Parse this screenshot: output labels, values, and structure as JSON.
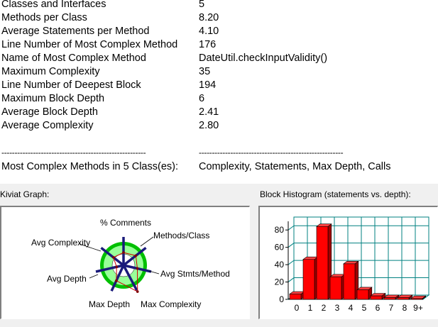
{
  "metrics": [
    {
      "label": "Classes and Interfaces",
      "value": "5"
    },
    {
      "label": "Methods per Class",
      "value": "8.20"
    },
    {
      "label": "Average Statements per Method",
      "value": "4.10"
    },
    {
      "label": "Line Number of Most Complex Method",
      "value": "176"
    },
    {
      "label": "Name of Most Complex Method",
      "value": "DateUtil.checkInputValidity()"
    },
    {
      "label": "Maximum Complexity",
      "value": "35"
    },
    {
      "label": "Line Number of Deepest Block",
      "value": "194"
    },
    {
      "label": "Maximum Block Depth",
      "value": "6"
    },
    {
      "label": "Average Block Depth",
      "value": "2.41"
    },
    {
      "label": "Average Complexity",
      "value": "2.80"
    }
  ],
  "separator_left": "-------------------------------------------------------",
  "separator_right": "-------------------------------------------------------",
  "most_complex": {
    "label": "Most Complex Methods in 5 Class(es):",
    "value": "Complexity, Statements, Max Depth, Calls"
  },
  "kiviat": {
    "title": "Kiviat Graph:",
    "axes": [
      "% Comments",
      "Methods/Class",
      "Avg Stmts/Method",
      "Max Complexity",
      "Max Depth",
      "Avg Depth",
      "Avg Complexity"
    ],
    "ring_color": "#99ff99",
    "outer_ring_color": "#00c000"
  },
  "chart_data": {
    "type": "bar",
    "title": "Block Histogram (statements vs. depth):",
    "categories": [
      "0",
      "1",
      "2",
      "3",
      "4",
      "5",
      "6",
      "7",
      "8",
      "9+"
    ],
    "values": [
      6,
      46,
      84,
      26,
      41,
      11,
      4,
      2,
      2,
      1
    ],
    "ylim": [
      0,
      90
    ],
    "yticks": [
      0,
      20,
      40,
      60,
      80
    ],
    "bar_color": "#ff0000",
    "grid_color": "#008080",
    "grid": true
  }
}
